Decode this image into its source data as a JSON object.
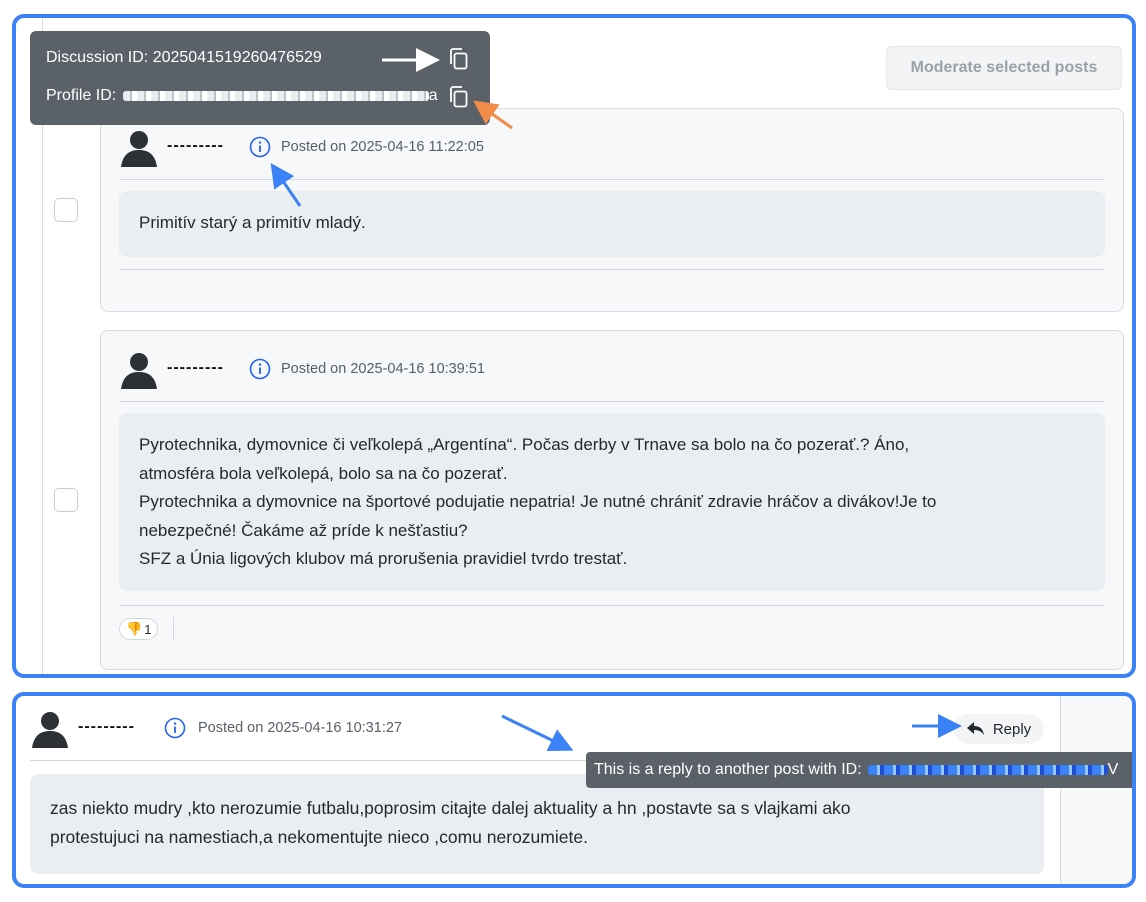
{
  "toolbar": {
    "moderate_label": "Moderate selected posts"
  },
  "id_tooltip": {
    "discussion_label": "Discussion ID: ",
    "discussion_value": "2025041519260476529",
    "profile_label": "Profile ID: ",
    "profile_value_tail": "a"
  },
  "posts": [
    {
      "author": "---------",
      "posted": "Posted on 2025-04-16 11:22:05",
      "body": "Primitív starý a primitív mladý."
    },
    {
      "author": "---------",
      "posted": "Posted on 2025-04-16 10:39:51",
      "body_lines": [
        "Pyrotechnika, dymovnice či veľkolepá „Argentína“. Počas derby v Trnave sa bolo na čo pozerať.? Áno,",
        "atmosféra bola veľkolepá, bolo sa na čo pozerať.",
        "Pyrotechnika a dymovnice na športové podujatie nepatria! Je nutné chrániť zdravie hráčov a  divákov!Je to",
        "nebezpečné!  Čakáme až príde k nešťastiu?",
        "SFZ a Únia ligových klubov má prorušenia pravidiel tvrdo trestať."
      ],
      "reaction": {
        "emoji": "👎",
        "count": "1"
      }
    }
  ],
  "reply_post": {
    "author": "---------",
    "posted": "Posted on 2025-04-16 10:31:27",
    "reply_label": "Reply",
    "reply_tooltip": "This is a reply to another post with ID: ",
    "reply_tooltip_tail": "V",
    "body_lines": [
      "zas niekto mudry ,kto nerozumie futbalu,poprosim citajte dalej aktuality a hn ,postavte sa s vlajkami ako",
      "protestujuci na namestiach,a nekomentujte nieco ,comu nerozumiete."
    ]
  },
  "colors": {
    "annotation_blue": "#3b82f6",
    "annotation_orange": "#f28c4a",
    "tooltip_bg": "#5b6168"
  },
  "icons": [
    "avatar-icon",
    "info-icon",
    "copy-icon",
    "reply-icon",
    "arrow-annotation"
  ]
}
